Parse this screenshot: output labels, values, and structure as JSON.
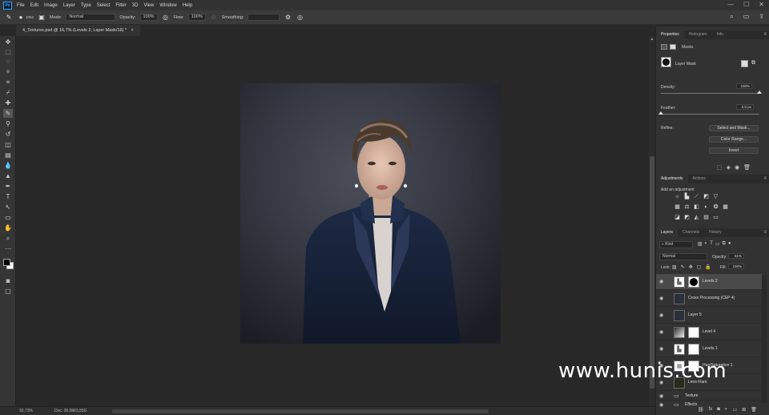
{
  "menubar": {
    "items": [
      "File",
      "Edit",
      "Image",
      "Layer",
      "Type",
      "Select",
      "Filter",
      "3D",
      "View",
      "Window",
      "Help"
    ],
    "window_controls": [
      "—",
      "☐",
      "✕"
    ]
  },
  "options": {
    "brush_size": "1052",
    "mode_label": "Mode:",
    "mode_value": "Normal",
    "opacity_label": "Opacity:",
    "opacity_value": "100%",
    "flow_label": "Flow:",
    "flow_value": "100%",
    "smoothing_label": "Smoothing:"
  },
  "document_tab": {
    "title": "4_Textures.psd @ 16,7% (Levels 2, Layer Mask/16) *"
  },
  "status": {
    "zoom": "16,73%",
    "doc": "Doc: 36,9M/1,55G"
  },
  "properties": {
    "tabs": [
      "Properties",
      "Histogram",
      "Info"
    ],
    "section": "Masks",
    "layer_mask_label": "Layer Mask",
    "density_label": "Density:",
    "density_value": "100%",
    "density_fraction": 1.0,
    "feather_label": "Feather:",
    "feather_value": "0,0 px",
    "feather_fraction": 0.0,
    "refine_label": "Refine:",
    "buttons": [
      "Select and Mask...",
      "Color Range...",
      "Invert"
    ]
  },
  "adjustments": {
    "tabs": [
      "Adjustments",
      "Actions"
    ],
    "heading": "Add an adjustment"
  },
  "layers": {
    "tabs": [
      "Layers",
      "Channels",
      "History"
    ],
    "kind_label": "Kind",
    "blend_mode": "Normal",
    "opacity_label": "Opacity:",
    "opacity_value": "51%",
    "lock_label": "Lock:",
    "fill_label": "Fill:",
    "fill_value": "100%",
    "rows": [
      {
        "name": "Levels 2",
        "selected": true,
        "mask": "black-circle"
      },
      {
        "name": "Cross Processing (CEP 4)",
        "selected": false,
        "mask": "none"
      },
      {
        "name": "Layer 5",
        "selected": false,
        "mask": "none"
      },
      {
        "name": "Level 4",
        "selected": false,
        "mask": "white"
      },
      {
        "name": "Levels 1",
        "selected": false,
        "mask": "white"
      },
      {
        "name": "Hue/Saturation 1",
        "selected": false,
        "mask": "white"
      },
      {
        "name": "Lens Flare",
        "selected": false,
        "mask": "none"
      },
      {
        "name": "Texture",
        "selected": false,
        "mask": "none"
      },
      {
        "name": "Effects",
        "selected": false,
        "mask": "none"
      }
    ]
  },
  "watermark": "www.hunis.com"
}
